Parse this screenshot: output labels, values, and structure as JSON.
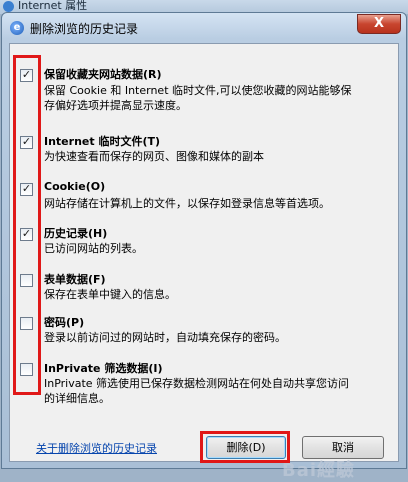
{
  "outer_window": {
    "title": "Internet 属性"
  },
  "dialog": {
    "title": "删除浏览的历史记录",
    "close_symbol": "X"
  },
  "options": [
    {
      "label": "保留收藏夹网站数据(R)",
      "checked": true,
      "desc": [
        "保留 Cookie 和 Internet 临时文件,可以使您收藏的网站能够保",
        "存偏好选项并提高显示速度。"
      ]
    },
    {
      "label": "Internet 临时文件(T)",
      "checked": true,
      "desc": [
        "为快速查看而保存的网页、图像和媒体的副本"
      ]
    },
    {
      "label": "Cookie(O)",
      "checked": true,
      "desc": [
        "网站存储在计算机上的文件，以保存如登录信息等首选项。"
      ]
    },
    {
      "label": "历史记录(H)",
      "checked": true,
      "desc": [
        "已访问网站的列表。"
      ]
    },
    {
      "label": "表单数据(F)",
      "checked": false,
      "desc": [
        "保存在表单中键入的信息。"
      ]
    },
    {
      "label": "密码(P)",
      "checked": false,
      "desc": [
        "登录以前访问过的网站时，自动填充保存的密码。"
      ]
    },
    {
      "label": "InPrivate 筛选数据(I)",
      "checked": false,
      "desc": [
        "InPrivate 筛选使用已保存数据检测网站在何处自动共享您访问",
        "的详细信息。"
      ]
    }
  ],
  "footer": {
    "about_link": "关于删除浏览的历史记录",
    "delete_button": "删除(D)",
    "cancel_button": "取消"
  },
  "watermark": "Bai經驗",
  "colors": {
    "highlight": "#e01818",
    "link": "#0645ad"
  }
}
